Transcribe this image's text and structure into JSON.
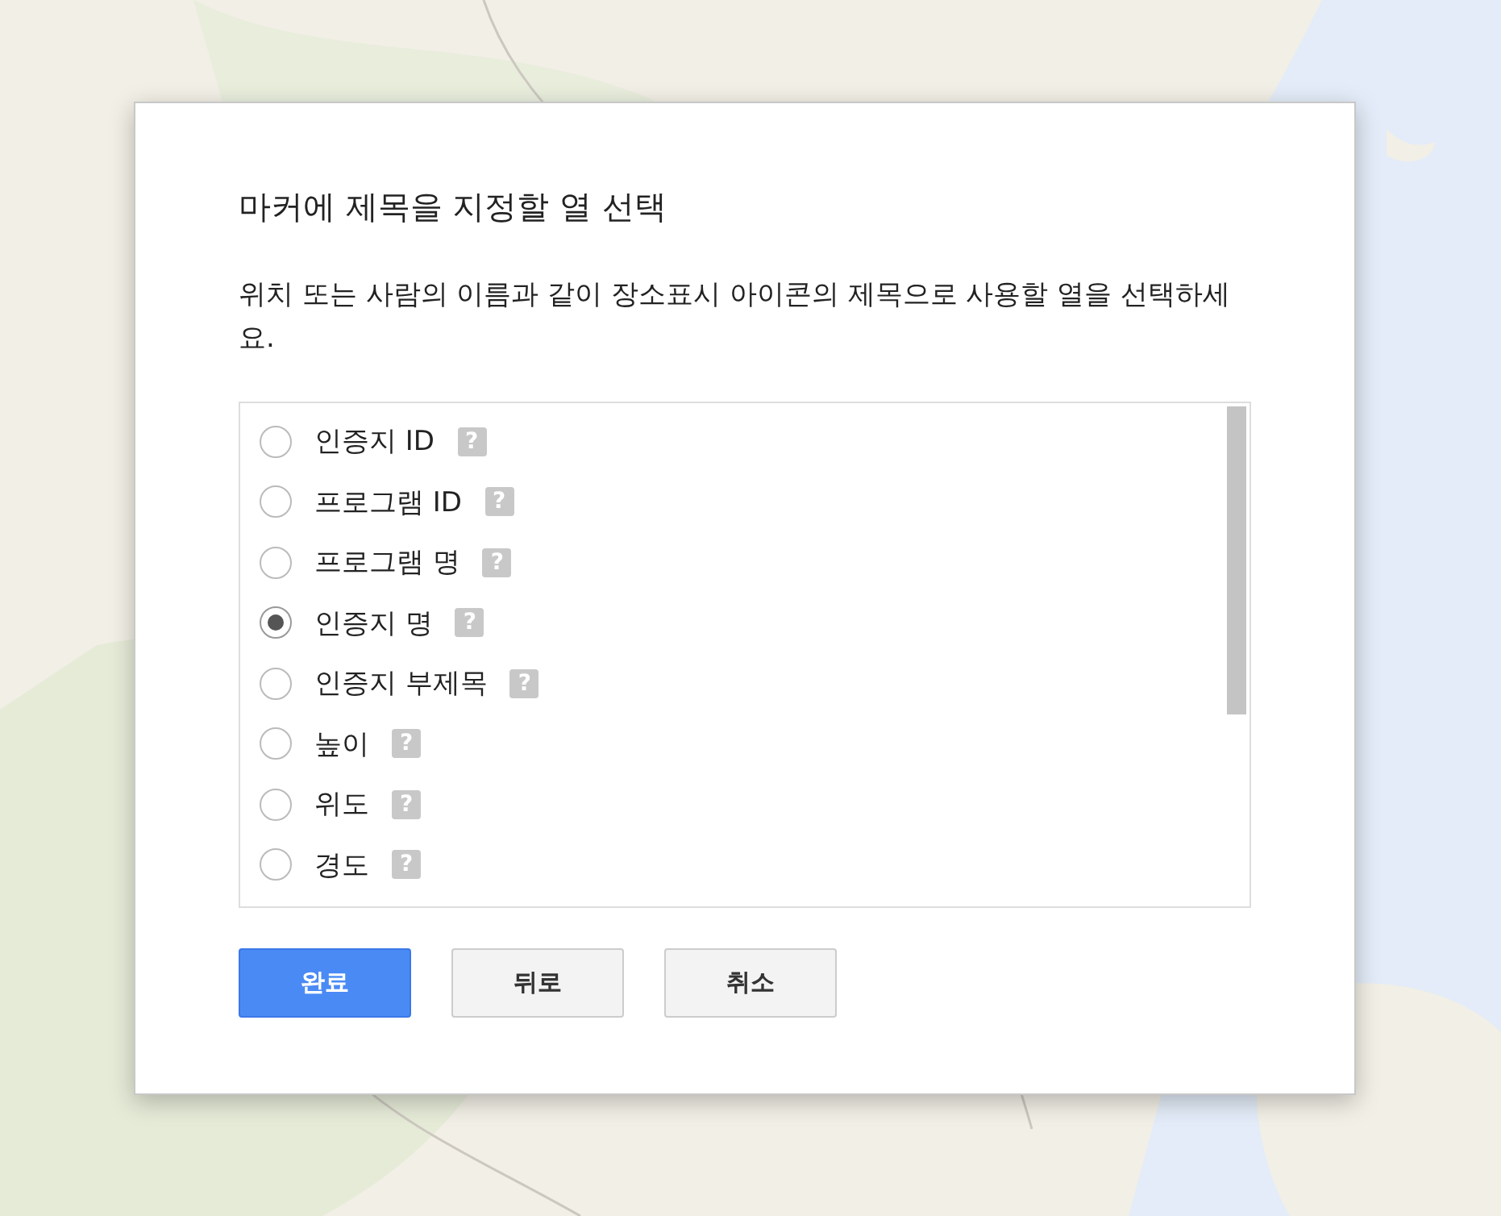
{
  "dialog": {
    "title": "마커에 제목을 지정할 열 선택",
    "description": "위치 또는 사람의 이름과 같이 장소표시 아이콘의 제목으로 사용할 열을 선택하세요.",
    "options": [
      {
        "label": "인증지 ID",
        "help": "?",
        "selected": false
      },
      {
        "label": "프로그램 ID",
        "help": "?",
        "selected": false
      },
      {
        "label": "프로그램 명",
        "help": "?",
        "selected": false
      },
      {
        "label": "인증지 명",
        "help": "?",
        "selected": true
      },
      {
        "label": "인증지 부제목",
        "help": "?",
        "selected": false
      },
      {
        "label": "높이",
        "help": "?",
        "selected": false
      },
      {
        "label": "위도",
        "help": "?",
        "selected": false
      },
      {
        "label": "경도",
        "help": "?",
        "selected": false
      }
    ],
    "buttons": [
      {
        "label": "완료",
        "kind": "primary"
      },
      {
        "label": "뒤로",
        "kind": "secondary"
      },
      {
        "label": "취소",
        "kind": "secondary"
      }
    ]
  }
}
